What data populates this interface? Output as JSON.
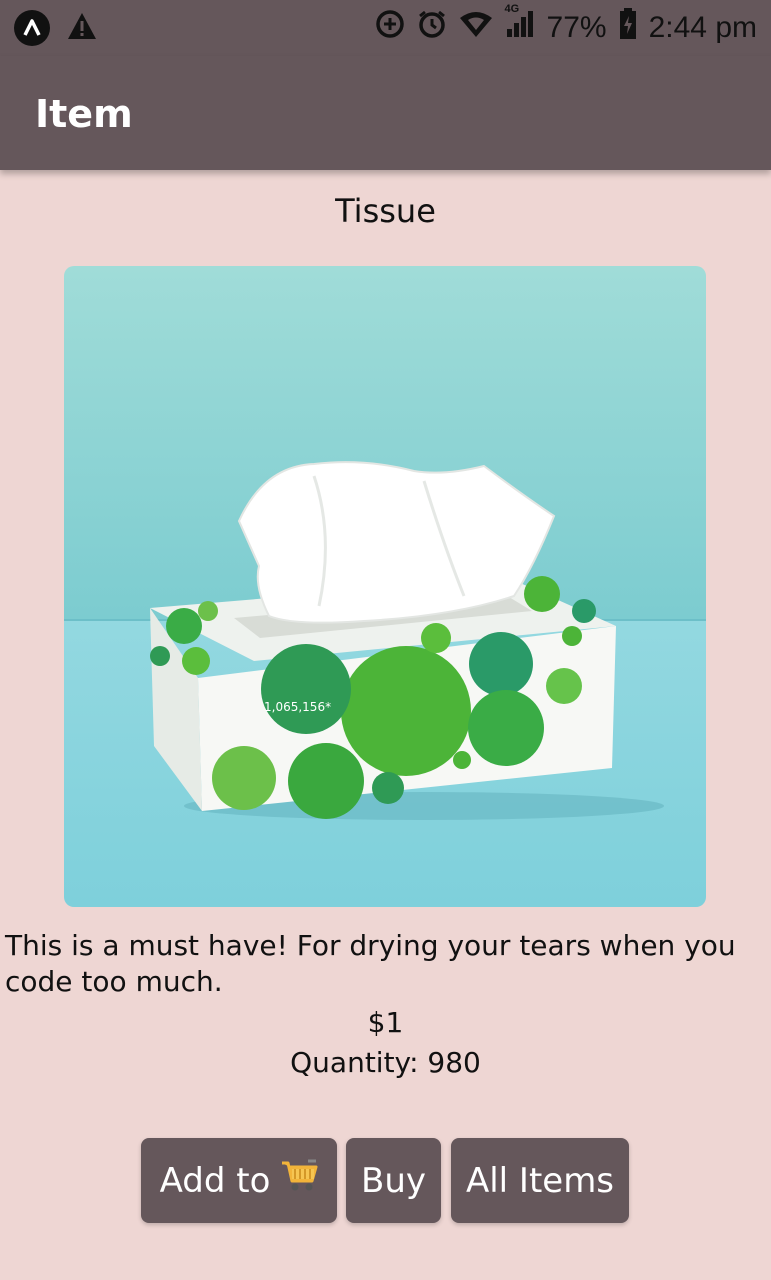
{
  "status_bar": {
    "battery": "77%",
    "network": "4G",
    "time": "2:44 pm"
  },
  "app_bar": {
    "title": "Item"
  },
  "item": {
    "name": "Tissue",
    "image_icon": "tissue-box-image",
    "description": "This is a must have! For drying your tears when you code too much.",
    "price": "$1",
    "quantity": "Quantity: 980",
    "box_print": "1,065,156*"
  },
  "buttons": {
    "add_label": "Add to",
    "add_icon": "shopping-cart-icon",
    "buy_label": "Buy",
    "all_items_label": "All Items"
  },
  "colors": {
    "primary": "#65575b",
    "background": "#eed6d3",
    "image_bg": "#8fd4d8"
  }
}
